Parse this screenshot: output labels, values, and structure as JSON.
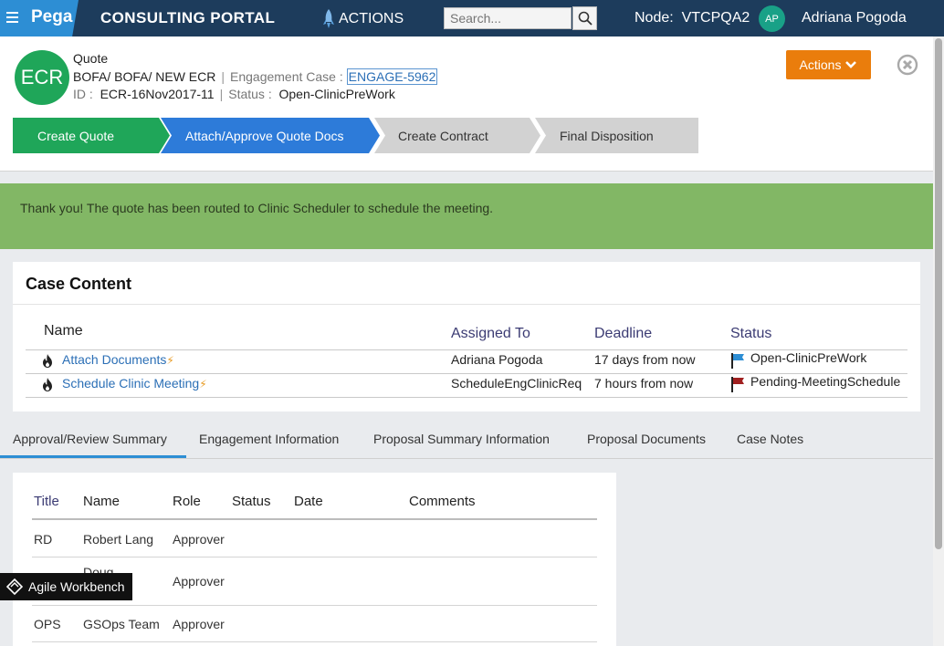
{
  "topbar": {
    "brand": "Pega",
    "portal_title": "CONSULTING PORTAL",
    "actions_label": "ACTIONS",
    "search_placeholder": "Search...",
    "node_label": "Node:",
    "node_value": "VTCPQA2",
    "user_initials": "AP",
    "user_name": "Adriana Pogoda"
  },
  "case": {
    "avatar_text": "ECR",
    "type": "Quote",
    "path": "BOFA/ BOFA/ NEW ECR",
    "engagement_label": "Engagement Case :",
    "engagement_id": "ENGAGE-5962",
    "id_label": "ID :",
    "id_value": "ECR-16Nov2017-11",
    "status_label": "Status :",
    "status_value": "Open-ClinicPreWork",
    "actions_button": "Actions"
  },
  "stages": [
    {
      "label": "Create Quote",
      "state": "completed"
    },
    {
      "label": "Attach/Approve Quote Docs",
      "state": "current"
    },
    {
      "label": "Create Contract",
      "state": "future"
    },
    {
      "label": "Final Disposition",
      "state": "future"
    }
  ],
  "banner": {
    "message": "Thank you! The quote has been routed to Clinic Scheduler to schedule the meeting."
  },
  "case_content": {
    "title": "Case Content",
    "headers": {
      "name": "Name",
      "assigned": "Assigned To",
      "deadline": "Deadline",
      "status": "Status"
    },
    "rows": [
      {
        "name": "Attach Documents",
        "assigned": "Adriana Pogoda",
        "deadline": "17 days from now",
        "status": "Open-ClinicPreWork",
        "flag_color": "#2d8ed4"
      },
      {
        "name": "Schedule Clinic Meeting",
        "assigned": "ScheduleEngClinicReq",
        "deadline": "7 hours from now",
        "status": "Pending-MeetingSchedule",
        "flag_color": "#a02020"
      }
    ]
  },
  "tabs": [
    {
      "label": "Approval/Review Summary",
      "active": true
    },
    {
      "label": "Engagement Information",
      "active": false
    },
    {
      "label": "Proposal Summary Information",
      "active": false
    },
    {
      "label": "Proposal Documents",
      "active": false
    },
    {
      "label": "Case Notes",
      "active": false
    }
  ],
  "summary": {
    "headers": {
      "title": "Title",
      "name": "Name",
      "role": "Role",
      "status": "Status",
      "date": "Date",
      "comments": "Comments"
    },
    "rows": [
      {
        "title": "RD",
        "name": "Robert Lang",
        "role": "Approver"
      },
      {
        "title": "",
        "name": "Doug",
        "role": "Approver"
      },
      {
        "title": "OPS",
        "name": "GSOps Team",
        "role": "Approver"
      }
    ]
  },
  "agile_workbench": "Agile Workbench",
  "colors": {
    "topbar": "#1d3c5c",
    "brand": "#2d8ed4",
    "stage_completed": "#1fa659",
    "stage_current": "#2d7bd9",
    "stage_future": "#d2d2d2",
    "banner": "#82b765",
    "actions_button": "#ea7d0c"
  }
}
